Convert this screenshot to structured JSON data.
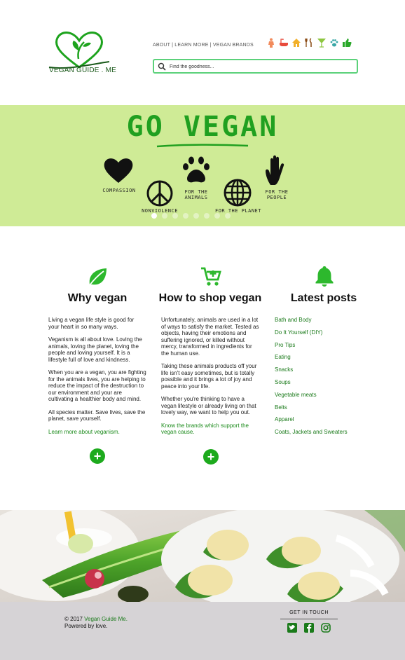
{
  "header": {
    "logo_text": "VEGAN GUIDE . ME",
    "top_links": "ABOUT | LEARN MORE | VEGAN BRANDS",
    "search_placeholder": "Find the goodness...",
    "category_icons": [
      "person-icon",
      "bath-icon",
      "home-icon",
      "dining-icon",
      "cocktail-icon",
      "paw-icon",
      "thumbs-up-icon"
    ]
  },
  "hero": {
    "title": "GO VEGAN",
    "items": [
      {
        "label": "COMPASSION",
        "icon": "heart-icon"
      },
      {
        "label": "NONVIOLENCE",
        "icon": "peace-icon"
      },
      {
        "label": "FOR THE\nANIMALS",
        "icon": "paw-icon"
      },
      {
        "label": "FOR THE PLANET",
        "icon": "globe-icon"
      },
      {
        "label": "FOR THE\nPEOPLE",
        "icon": "hand-icon"
      }
    ],
    "slide_count": 8,
    "active_slide": 1
  },
  "columns": {
    "why": {
      "title": "Why vegan",
      "icon": "leaf-icon",
      "paragraphs": [
        "Living a vegan life style is good for your heart in so many ways.",
        "Veganism is all about love. Loving the animals, loving the planet, loving the people and loving yourself. It is a lifestyle full of love and kindness.",
        "When you are a vegan, you are fighting for the animals lives, you are helping to reduce the impact of the destruction to our environment and your are cultivating a healthier body and mind.",
        "All species matter. Save lives, save the planet, save yourself."
      ],
      "link": "Learn more about veganism."
    },
    "shop": {
      "title": "How to shop vegan",
      "icon": "cart-icon",
      "paragraphs": [
        "Unfortunately, animals are used in a lot of ways to satisfy the market. Tested as objects, having their emotions and suffering ignored, or killed without mercy, transformed in ingredients for the human use.",
        "Taking these animals products off your life isn't easy sometimes, but is totally possible and it brings a lot of joy and peace into your life.",
        "Whether you're thinking to have a vegan lifestyle or already living on that lovely way, we want to help you out."
      ],
      "link": "Know the brands which support the vegan cause."
    },
    "posts": {
      "title": "Latest posts",
      "icon": "bell-icon",
      "items": [
        "Bath and Body",
        "Do It Yourself (DIY)",
        "Pro Tips",
        "Eating",
        "Snacks",
        "Soups",
        "Vegetable meats",
        "Belts",
        "Apparel",
        "Coats, Jackets and Sweaters"
      ]
    }
  },
  "footer": {
    "copyright_prefix": "© 2017 ",
    "site_name": "Vegan Guide Me.",
    "powered": "Powered by love.",
    "get_in_touch": "GET IN TOUCH",
    "social": [
      "twitter-icon",
      "facebook-icon",
      "instagram-icon"
    ]
  },
  "colors": {
    "brand_green": "#1daa1d",
    "hero_bg": "#cfeb96",
    "footer_bg": "#d6d3d6"
  }
}
